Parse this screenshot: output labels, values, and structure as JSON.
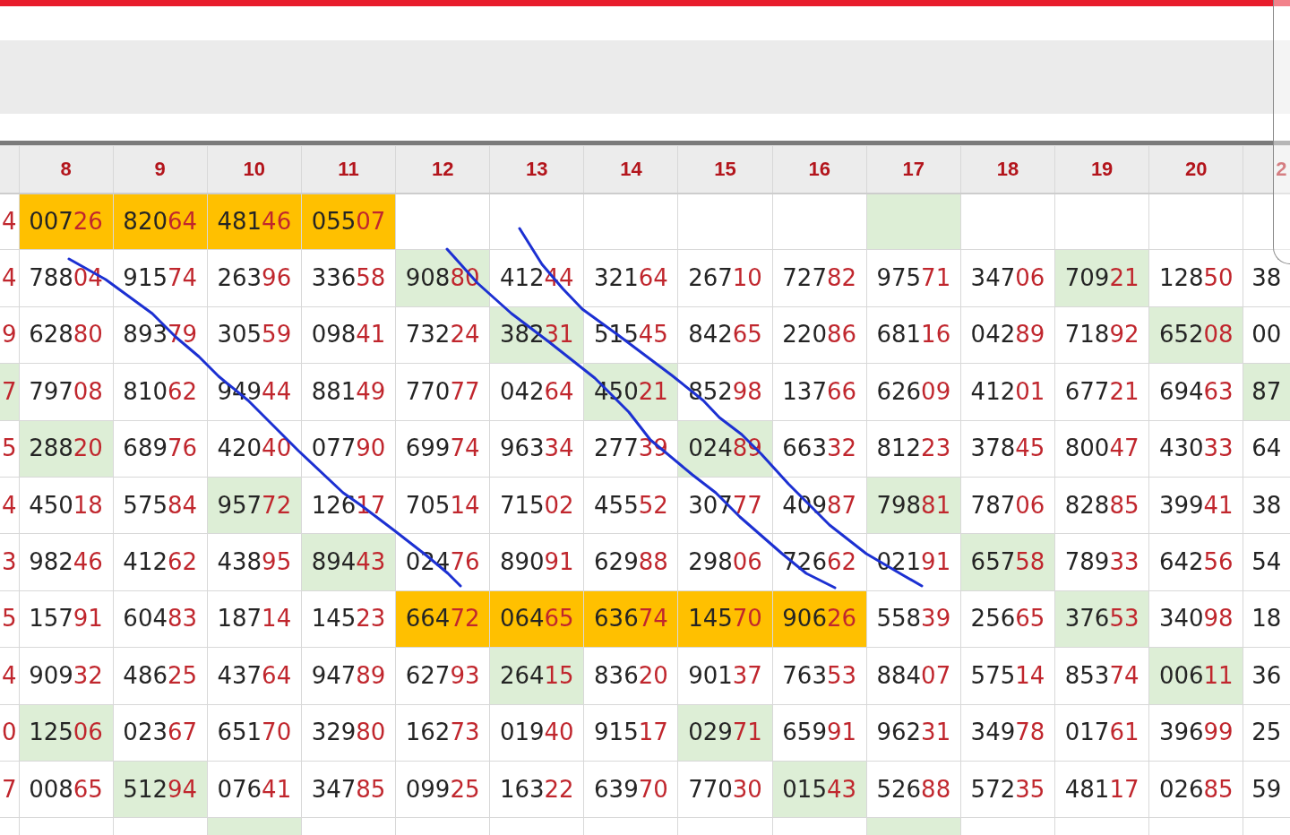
{
  "table": {
    "columns": [
      "8",
      "9",
      "10",
      "11",
      "12",
      "13",
      "14",
      "15",
      "16",
      "17",
      "18",
      "19",
      "20"
    ],
    "cut_column": "2",
    "rows": [
      {
        "left": {
          "text": "4"
        },
        "cells": [
          {
            "number": "00726",
            "color": "#ffc000"
          },
          {
            "number": "82064",
            "color": "#ffc000"
          },
          {
            "number": "48146",
            "color": "#ffc000"
          },
          {
            "number": "05507",
            "color": "#ffc000"
          },
          null,
          null,
          null,
          null,
          null,
          {
            "color": "#ddeed6"
          },
          null,
          null,
          null
        ]
      },
      {
        "left": {
          "text": "4"
        },
        "cells": [
          {
            "number": "78804"
          },
          {
            "number": "91574"
          },
          {
            "number": "26396"
          },
          {
            "number": "33658"
          },
          {
            "number": "90880",
            "color": "#ddeed6"
          },
          {
            "number": "41244"
          },
          {
            "number": "32164"
          },
          {
            "number": "26710"
          },
          {
            "number": "72782"
          },
          {
            "number": "97571"
          },
          {
            "number": "34706"
          },
          {
            "number": "70921",
            "color": "#ddeed6"
          },
          {
            "number": "12850"
          }
        ],
        "right": {
          "text": "38"
        }
      },
      {
        "left": {
          "text": "9"
        },
        "cells": [
          {
            "number": "62880"
          },
          {
            "number": "89379"
          },
          {
            "number": "30559"
          },
          {
            "number": "09841"
          },
          {
            "number": "73224"
          },
          {
            "number": "38231",
            "color": "#ddeed6"
          },
          {
            "number": "51545"
          },
          {
            "number": "84265"
          },
          {
            "number": "22086"
          },
          {
            "number": "68116"
          },
          {
            "number": "04289"
          },
          {
            "number": "71892"
          },
          {
            "number": "65208",
            "color": "#ddeed6"
          }
        ],
        "right": {
          "text": "00"
        }
      },
      {
        "left": {
          "text": "7",
          "color": "#ddeed6"
        },
        "cells": [
          {
            "number": "79708"
          },
          {
            "number": "81062"
          },
          {
            "number": "94944"
          },
          {
            "number": "88149"
          },
          {
            "number": "77077"
          },
          {
            "number": "04264"
          },
          {
            "number": "45021",
            "color": "#ddeed6"
          },
          {
            "number": "85298"
          },
          {
            "number": "13766"
          },
          {
            "number": "62609"
          },
          {
            "number": "41201"
          },
          {
            "number": "67721"
          },
          {
            "number": "69463"
          }
        ],
        "right": {
          "text": "87",
          "color": "#ddeed6"
        }
      },
      {
        "left": {
          "text": "5"
        },
        "cells": [
          {
            "number": "28820",
            "color": "#ddeed6"
          },
          {
            "number": "68976"
          },
          {
            "number": "42040"
          },
          {
            "number": "07790"
          },
          {
            "number": "69974"
          },
          {
            "number": "96334"
          },
          {
            "number": "27739"
          },
          {
            "number": "02489",
            "color": "#ddeed6"
          },
          {
            "number": "66332"
          },
          {
            "number": "81223"
          },
          {
            "number": "37845"
          },
          {
            "number": "80047"
          },
          {
            "number": "43033"
          }
        ],
        "right": {
          "text": "64"
        }
      },
      {
        "left": {
          "text": "4"
        },
        "cells": [
          {
            "number": "45018"
          },
          {
            "number": "57584"
          },
          {
            "number": "95772",
            "color": "#ddeed6"
          },
          {
            "number": "12617"
          },
          {
            "number": "70514"
          },
          {
            "number": "71502"
          },
          {
            "number": "45552"
          },
          {
            "number": "30777"
          },
          {
            "number": "40987"
          },
          {
            "number": "79881",
            "color": "#ddeed6"
          },
          {
            "number": "78706"
          },
          {
            "number": "82885"
          },
          {
            "number": "39941"
          }
        ],
        "right": {
          "text": "38"
        }
      },
      {
        "left": {
          "text": "3"
        },
        "cells": [
          {
            "number": "98246"
          },
          {
            "number": "41262"
          },
          {
            "number": "43895"
          },
          {
            "number": "89443",
            "color": "#ddeed6"
          },
          {
            "number": "02476"
          },
          {
            "number": "89091"
          },
          {
            "number": "62988"
          },
          {
            "number": "29806"
          },
          {
            "number": "72662"
          },
          {
            "number": "02191"
          },
          {
            "number": "65758",
            "color": "#ddeed6"
          },
          {
            "number": "78933"
          },
          {
            "number": "64256"
          }
        ],
        "right": {
          "text": "54"
        }
      },
      {
        "left": {
          "text": "5"
        },
        "cells": [
          {
            "number": "15791"
          },
          {
            "number": "60483"
          },
          {
            "number": "18714"
          },
          {
            "number": "14523"
          },
          {
            "number": "66472",
            "color": "#ffc000"
          },
          {
            "number": "06465",
            "color": "#ffc000"
          },
          {
            "number": "63674",
            "color": "#ffc000"
          },
          {
            "number": "14570",
            "color": "#ffc000"
          },
          {
            "number": "90626",
            "color": "#ffc000"
          },
          {
            "number": "55839"
          },
          {
            "number": "25665"
          },
          {
            "number": "37653",
            "color": "#ddeed6"
          },
          {
            "number": "34098"
          }
        ],
        "right": {
          "text": "18"
        }
      },
      {
        "left": {
          "text": "4"
        },
        "cells": [
          {
            "number": "90932"
          },
          {
            "number": "48625"
          },
          {
            "number": "43764"
          },
          {
            "number": "94789"
          },
          {
            "number": "62793"
          },
          {
            "number": "26415",
            "color": "#ddeed6"
          },
          {
            "number": "83620"
          },
          {
            "number": "90137"
          },
          {
            "number": "76353"
          },
          {
            "number": "88407"
          },
          {
            "number": "57514"
          },
          {
            "number": "85374"
          },
          {
            "number": "00611",
            "color": "#ddeed6"
          }
        ],
        "right": {
          "text": "36"
        }
      },
      {
        "left": {
          "text": "0"
        },
        "cells": [
          {
            "number": "12506",
            "color": "#ddeed6"
          },
          {
            "number": "02367"
          },
          {
            "number": "65170"
          },
          {
            "number": "32980"
          },
          {
            "number": "16273"
          },
          {
            "number": "01940"
          },
          {
            "number": "91517"
          },
          {
            "number": "02971",
            "color": "#ddeed6"
          },
          {
            "number": "65991"
          },
          {
            "number": "96231"
          },
          {
            "number": "34978"
          },
          {
            "number": "01761"
          },
          {
            "number": "39699"
          }
        ],
        "right": {
          "text": "25"
        }
      },
      {
        "left": {
          "text": "7"
        },
        "cells": [
          {
            "number": "00865"
          },
          {
            "number": "51294",
            "color": "#ddeed6"
          },
          {
            "number": "07641"
          },
          {
            "number": "34785"
          },
          {
            "number": "09925"
          },
          {
            "number": "16322"
          },
          {
            "number": "63970"
          },
          {
            "number": "77030"
          },
          {
            "number": "01543",
            "color": "#ddeed6"
          },
          {
            "number": "52688"
          },
          {
            "number": "57235"
          },
          {
            "number": "48117"
          },
          {
            "number": "02685"
          }
        ],
        "right": {
          "text": "59"
        }
      },
      {
        "cells": [
          null,
          null,
          {
            "color": "#ddeed6"
          },
          null,
          null,
          null,
          null,
          null,
          null,
          {
            "color": "#ddeed6"
          },
          null,
          null,
          null
        ]
      }
    ]
  },
  "annotations": [
    {
      "kind": "pen_stroke"
    },
    {
      "kind": "pen_stroke"
    },
    {
      "kind": "pen_stroke"
    }
  ]
}
